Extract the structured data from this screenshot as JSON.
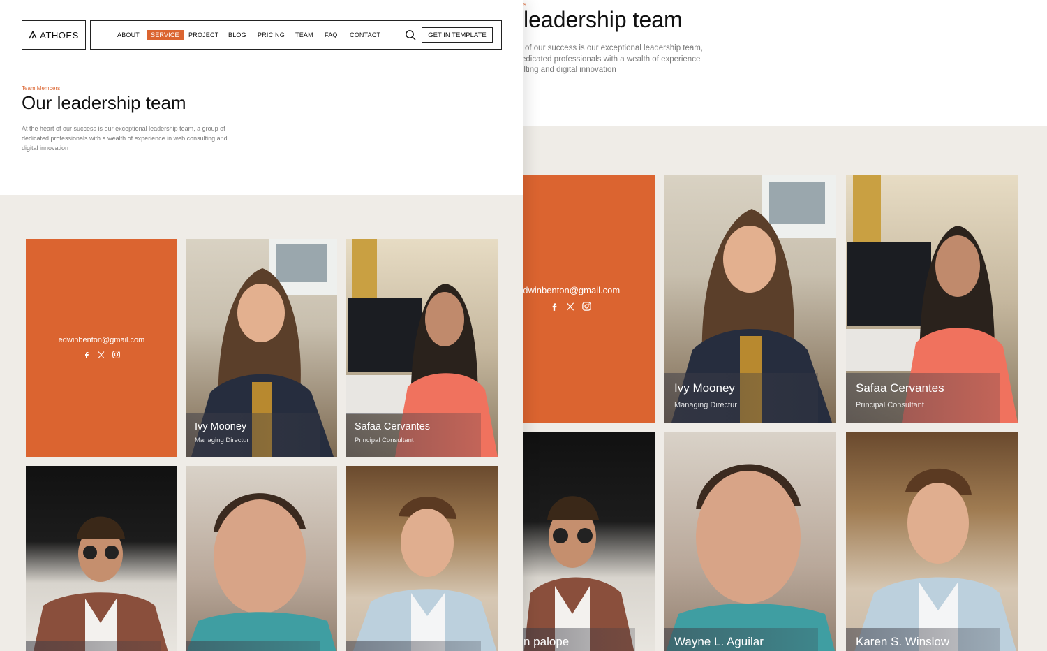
{
  "brand": {
    "name": "ATHOES"
  },
  "nav": {
    "items": [
      {
        "label": "ABOUT",
        "active": false
      },
      {
        "label": "SERVICE",
        "active": true
      },
      {
        "label": "PROJECT",
        "active": false
      },
      {
        "label": "BLOG",
        "active": false
      },
      {
        "label": "PRICING",
        "active": false
      },
      {
        "label": "TEAM",
        "active": false
      },
      {
        "label": "FAQ",
        "active": false
      },
      {
        "label": "CONTACT",
        "active": false
      }
    ],
    "search_icon": "search-icon",
    "cta_label": "GET IN TEMPLATE"
  },
  "hero": {
    "eyebrow": "Team Members",
    "title": "Our leadership team",
    "description": "At the heart of our success is our exceptional leadership team, a group of dedicated professionals with a wealth of experience in web consulting and digital innovation"
  },
  "zoom_view": {
    "eyebrow_fragment": "s",
    "title_fragment": "leadership team",
    "description_lines": [
      "of our success is our exceptional leadership team,",
      "edicated professionals with a wealth of experience",
      "ulting and digital innovation"
    ]
  },
  "contact_card": {
    "email": "edwinbenton@gmail.com",
    "socials": [
      "facebook-icon",
      "x-icon",
      "instagram-icon"
    ]
  },
  "team": [
    {
      "name": "Ivy Mooney",
      "role": "Managing Directur"
    },
    {
      "name": "Safaa Cervantes",
      "role": "Principal Consultant"
    },
    {
      "name": "n palope",
      "role": ""
    },
    {
      "name": "Wayne L. Aguilar",
      "role": ""
    },
    {
      "name": "Karen S. Winslow",
      "role": ""
    }
  ],
  "colors": {
    "accent": "#db6430",
    "cream_bg": "#efece7",
    "text_dark": "#111111",
    "text_muted": "#7a7a7a"
  }
}
